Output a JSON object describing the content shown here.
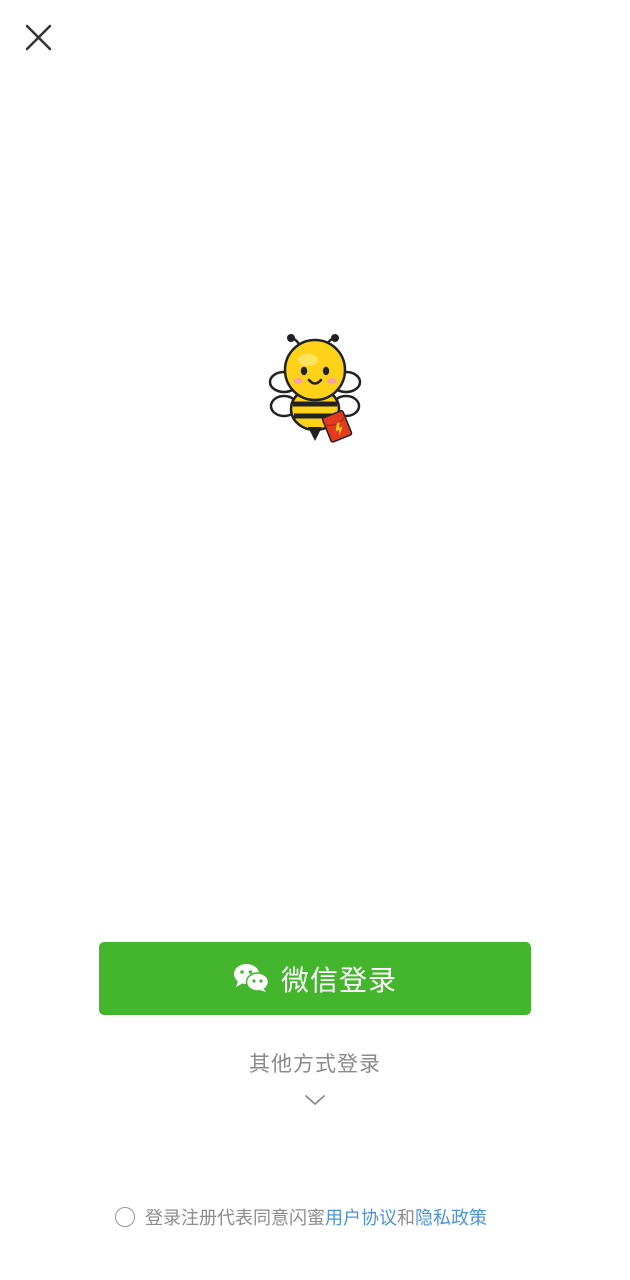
{
  "icons": {
    "close": "close-icon",
    "logo": "bee-mascot-logo",
    "wechat": "wechat-icon",
    "chevron": "chevron-down-icon"
  },
  "login": {
    "wechat_label": "微信登录",
    "other_label": "其他方式登录"
  },
  "agreement": {
    "prefix": "登录注册代表同意闪蜜",
    "user_agreement": "用户协议",
    "conjunction": "和",
    "privacy_policy": "隐私政策",
    "checked": false
  },
  "colors": {
    "primary_green": "#44b62e",
    "link_blue": "#4e92d8",
    "muted_text": "#8a8a8a"
  }
}
